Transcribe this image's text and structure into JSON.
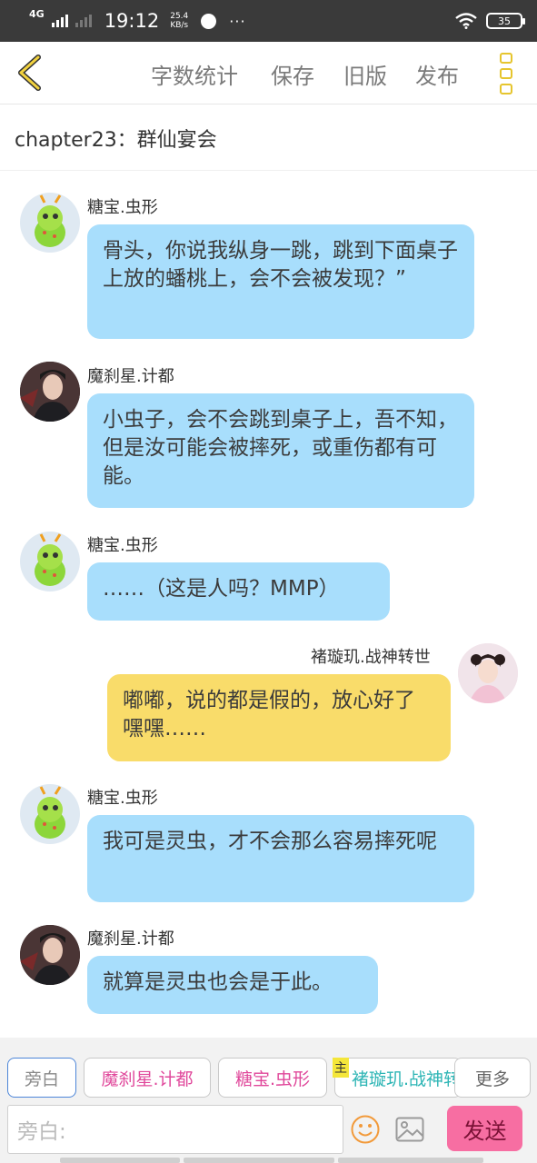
{
  "status_bar": {
    "network": "4G",
    "time": "19:12",
    "speed_value": "25.4",
    "speed_unit": "KB/s",
    "more": "···",
    "battery": "35"
  },
  "toolbar": {
    "word_count": "字数统计",
    "save": "保存",
    "old_version": "旧版",
    "publish": "发布"
  },
  "chapter_title": "chapter23：群仙宴会",
  "messages": [
    {
      "name": "糖宝.虫形",
      "text": "骨头，你说我纵身一跳，跳到下面桌子上放的蟠桃上，会不会被发现？”"
    },
    {
      "name": "魔刹星.计都",
      "text": "小虫子，会不会跳到桌子上，吾不知，但是汝可能会被摔死，或重伤都有可能。"
    },
    {
      "name": "糖宝.虫形",
      "text": "……（这是人吗？MMP）"
    },
    {
      "name": "褚璇玑.战神转世",
      "text": "嘟嘟，说的都是假的，放心好了嘿嘿……"
    },
    {
      "name": "糖宝.虫形",
      "text": "我可是灵虫，才不会那么容易摔死呢"
    },
    {
      "name": "魔刹星.计都",
      "text": "就算是灵虫也会是于此。"
    }
  ],
  "characters": {
    "narrator": "旁白",
    "c1": "魔刹星.计都",
    "c2": "糖宝.虫形",
    "c3": "褚璇玑.战神转世",
    "main_badge": "主",
    "more": "更多"
  },
  "input": {
    "placeholder": "旁白:",
    "send": "发送"
  },
  "colors": {
    "bubble_other": "#a8defc",
    "bubble_self": "#f9dc6a",
    "send_button": "#f76ea2",
    "accent_yellow": "#e6c52e",
    "character_pink": "#e0489b",
    "character_teal": "#2db5b5"
  }
}
